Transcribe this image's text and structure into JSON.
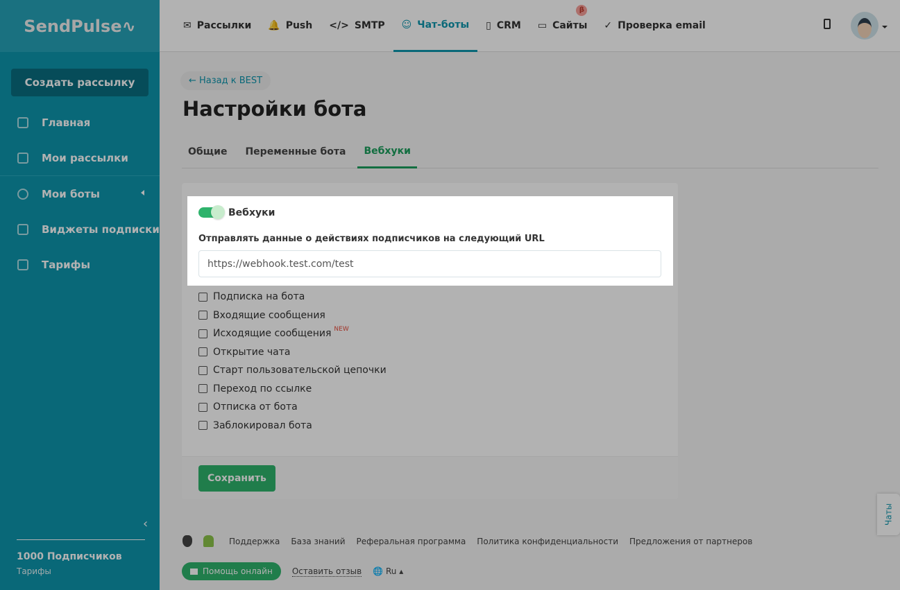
{
  "brand": "SendPulse",
  "sidebar": {
    "create_button": "Создать рассылку",
    "items": [
      {
        "label": "Главная"
      },
      {
        "label": "Мои рассылки"
      },
      {
        "label": "Мои боты"
      },
      {
        "label": "Виджеты подписки"
      },
      {
        "label": "Тарифы"
      }
    ],
    "subscribers": "1000 Подписчиков",
    "plan_link": "Тарифы"
  },
  "topnav": {
    "items": [
      {
        "icon": "✉",
        "label": "Рассылки"
      },
      {
        "icon": "🔔",
        "label": "Push"
      },
      {
        "icon": "</>",
        "label": "SMTP"
      },
      {
        "icon": "☺",
        "label": "Чат-боты"
      },
      {
        "icon": "▯",
        "label": "CRM"
      },
      {
        "icon": "▭",
        "label": "Сайты"
      },
      {
        "icon": "✓",
        "label": "Проверка email"
      }
    ],
    "beta_badge": "β"
  },
  "page": {
    "back_link": "← Назад к BEST",
    "title": "Настройки бота",
    "tabs": [
      "Общие",
      "Переменные бота",
      "Вебхуки"
    ]
  },
  "webhooks": {
    "toggle_label": "Вебхуки",
    "toggle_on": true,
    "url_label": "Отправлять данные о действиях подписчиков на следующий URL",
    "url_value": "https://webhook.test.com/test",
    "events": [
      {
        "label": "Подписка на бота",
        "checked": false
      },
      {
        "label": "Входящие сообщения",
        "checked": false
      },
      {
        "label": "Исходящие сообщения",
        "checked": false,
        "badge": "NEW"
      },
      {
        "label": "Открытие чата",
        "checked": false
      },
      {
        "label": "Старт пользовательской цепочки",
        "checked": false
      },
      {
        "label": "Переход по ссылке",
        "checked": false
      },
      {
        "label": "Отписка от бота",
        "checked": false
      },
      {
        "label": "Заблокировал бота",
        "checked": false
      }
    ],
    "save_button": "Сохранить"
  },
  "footer": {
    "links": [
      "Поддержка",
      "База знаний",
      "Реферальная программа",
      "Политика конфиденциальности",
      "Предложения от партнеров"
    ],
    "help_button": "Помощь онлайн",
    "review_link": "Оставить отзыв",
    "language": "Ru"
  },
  "chats_tab": "Чаты"
}
